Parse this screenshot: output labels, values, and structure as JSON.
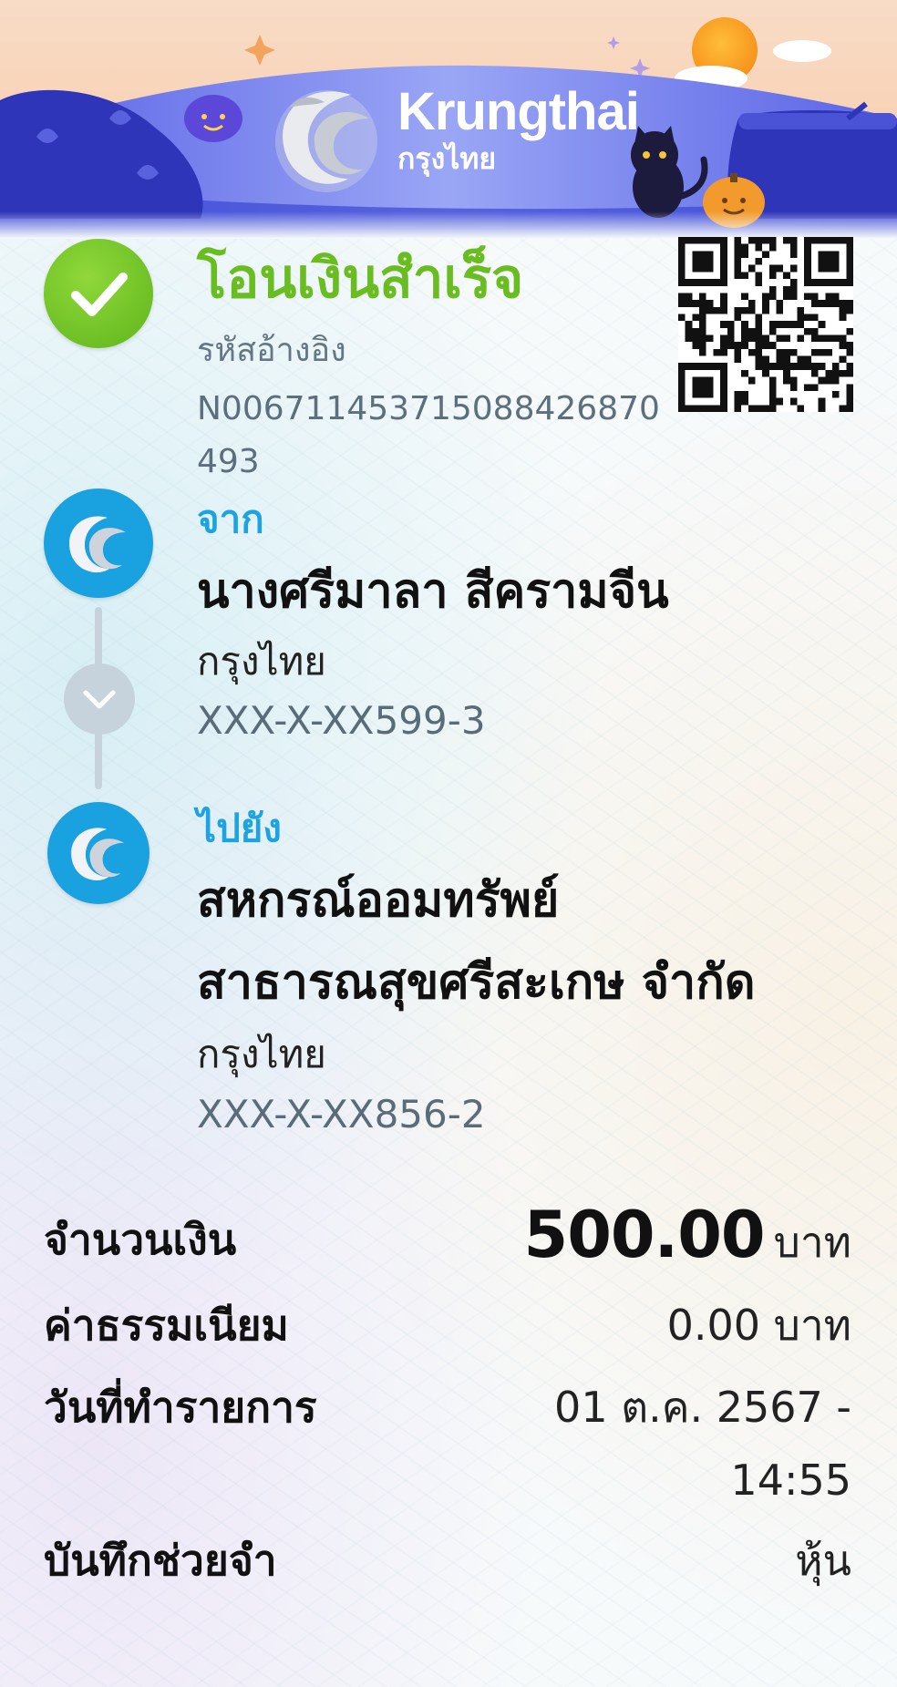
{
  "header": {
    "brand_en": "Krungthai",
    "brand_th": "กรุงไทย"
  },
  "status": {
    "title": "โอนเงินสำเร็จ",
    "ref_label": "รหัสอ้างอิง",
    "ref_value": "N006711453715088426870493"
  },
  "from": {
    "label": "จาก",
    "name": "นางศรีมาลา สีครามจีน",
    "bank": "กรุงไทย",
    "account": "XXX-X-XX599-3"
  },
  "to": {
    "label": "ไปยัง",
    "name_line1": "สหกรณ์ออมทรัพย์",
    "name_line2": "สาธารณสุขศรีสะเกษ จำกัด",
    "bank": "กรุงไทย",
    "account": "XXX-X-XX856-2"
  },
  "details": {
    "amount_label": "จำนวนเงิน",
    "amount_value": "500.00",
    "amount_unit": "บาท",
    "fee_label": "ค่าธรรมเนียม",
    "fee_value": "0.00 บาท",
    "date_label": "วันที่ทำรายการ",
    "date_line1": "01 ต.ค. 2567 -",
    "date_line2": "14:55",
    "memo_label": "บันทึกช่วยจำ",
    "memo_value": "หุ้น"
  },
  "icons": {
    "status": "check-icon",
    "bank": "krungthai-logo-icon",
    "arrow": "chevron-down-icon",
    "qr": "qr-code-icon"
  },
  "colors": {
    "success_green": "#6abd21",
    "brand_blue": "#1da3e2",
    "banner_blue": "#3f4bd6",
    "muted_gray": "#5b6c79"
  }
}
